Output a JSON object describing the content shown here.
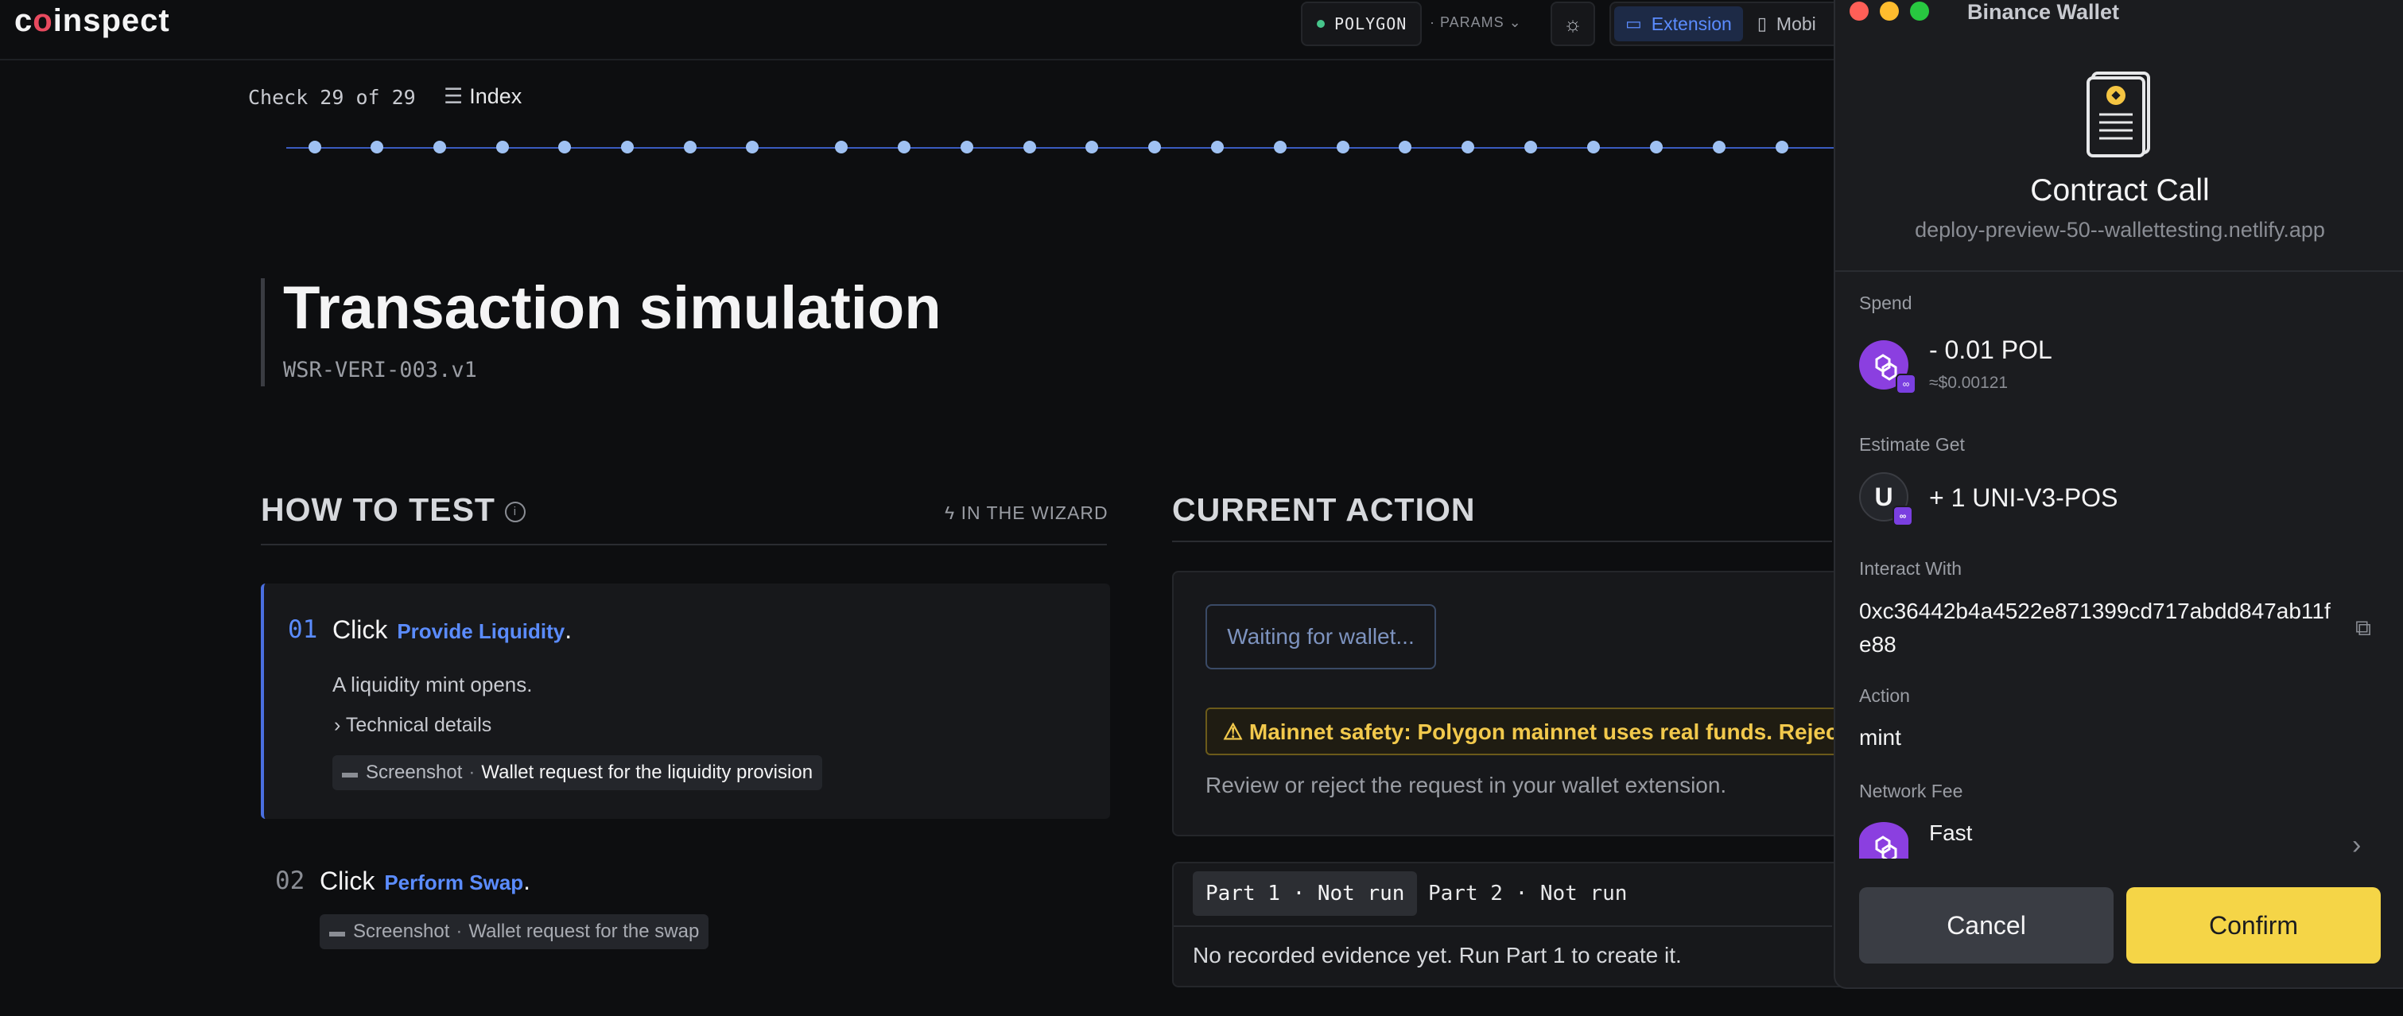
{
  "topbar": {
    "logo_pre": "c",
    "logo_o": "o",
    "logo_post": "inspect",
    "network": "POLYGON",
    "params": "· PARAMS ⌄",
    "mode_extension": "Extension",
    "mode_mobile": "Mobi"
  },
  "progress": {
    "check": "Check 29 of 29",
    "index": "Index",
    "step_count": 24
  },
  "test": {
    "title": "Transaction simulation",
    "id": "WSR-VERI-003.v1"
  },
  "how_to_test": {
    "heading": "HOW TO TEST",
    "wizard": "IN THE WIZARD",
    "steps": [
      {
        "num": "01",
        "verb": "Click",
        "target": "Provide Liquidity",
        "suffix": ".",
        "desc": "A liquidity mint opens.",
        "tech": "Technical details",
        "shot_label": "Screenshot",
        "shot_sep": "·",
        "shot_value": "Wallet request for the liquidity provision"
      },
      {
        "num": "02",
        "verb": "Click",
        "target": "Perform Swap",
        "suffix": ".",
        "shot_label": "Screenshot",
        "shot_sep": "·",
        "shot_value": "Wallet request for the swap"
      }
    ]
  },
  "current_action": {
    "heading": "CURRENT ACTION",
    "waiting": "Waiting for wallet...",
    "warning": "⚠ Mainnet safety: Polygon mainnet uses real funds. Reject ev",
    "review": "Review or reject the request in your wallet extension.",
    "part1": "Part 1 · Not run",
    "part2": "Part 2 · Not run",
    "no_evidence": "No recorded evidence yet. Run Part 1 to create it."
  },
  "wallet": {
    "window_title": "Binance Wallet",
    "heading": "Contract Call",
    "site": "deploy-preview-50--wallettesting.netlify.app",
    "spend_label": "Spend",
    "spend_value": "- 0.01 POL",
    "spend_usd": "≈$0.00121",
    "get_label": "Estimate Get",
    "get_icon_letter": "U",
    "get_value": "+ 1 UNI-V3-POS",
    "interact_label": "Interact With",
    "address": "0xc36442b4a4522e871399cd717abdd847ab11fe88",
    "action_label": "Action",
    "action_value": "mint",
    "fee_label": "Network Fee",
    "fee_speed": "Fast",
    "cancel": "Cancel",
    "confirm": "Confirm"
  },
  "colors": {
    "accent": "#5b8cff",
    "confirm": "#f5d547",
    "warning": "#f2c94c",
    "polygon": "#8b3fe0"
  }
}
